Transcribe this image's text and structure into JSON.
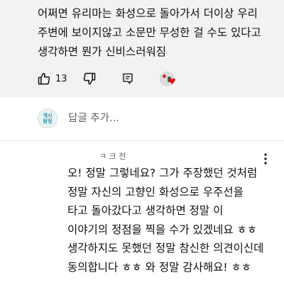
{
  "parent_comment": {
    "lines": [
      "어쩌면 유리마는 화성으로 돌아가서 더이상 우리",
      "주변에 보이지않고 소문만 무성한 걸 수도 있다고",
      "생각하면 뭔가 신비스러워짐"
    ],
    "like_count": "13",
    "icons": {
      "like": "thumbs-up-icon",
      "dislike": "thumbs-down-icon",
      "reply": "reply-icon",
      "creator_heart": "creator-heart-icon"
    },
    "heart_color": "#e31212"
  },
  "reply_box": {
    "avatar_text_line1": "게시",
    "avatar_text_line2": "탐정",
    "placeholder": "답글 추가..."
  },
  "reply": {
    "meta": "ㅋ 크 전",
    "lines": [
      "오! 정말 그렇네요? 그가 주장했던 것처럼",
      "정말 자신의 고향인 화성으로 우주선을",
      "타고 돌아갔다고 생각하면 정말 이",
      "이야기의 정점을 찍을 수가 있겠네요 ㅎㅎ",
      "생각하지도 못했던 정말 참신한 의견이신데",
      "동의합니다 ㅎㅎ 와 정말 감사해요! ㅎㅎ"
    ],
    "more_icon": "more-vertical-icon"
  },
  "colors": {
    "top_block_bg": "#f2f2f2",
    "text": "#0f0f0f",
    "secondary_text": "#606060"
  }
}
